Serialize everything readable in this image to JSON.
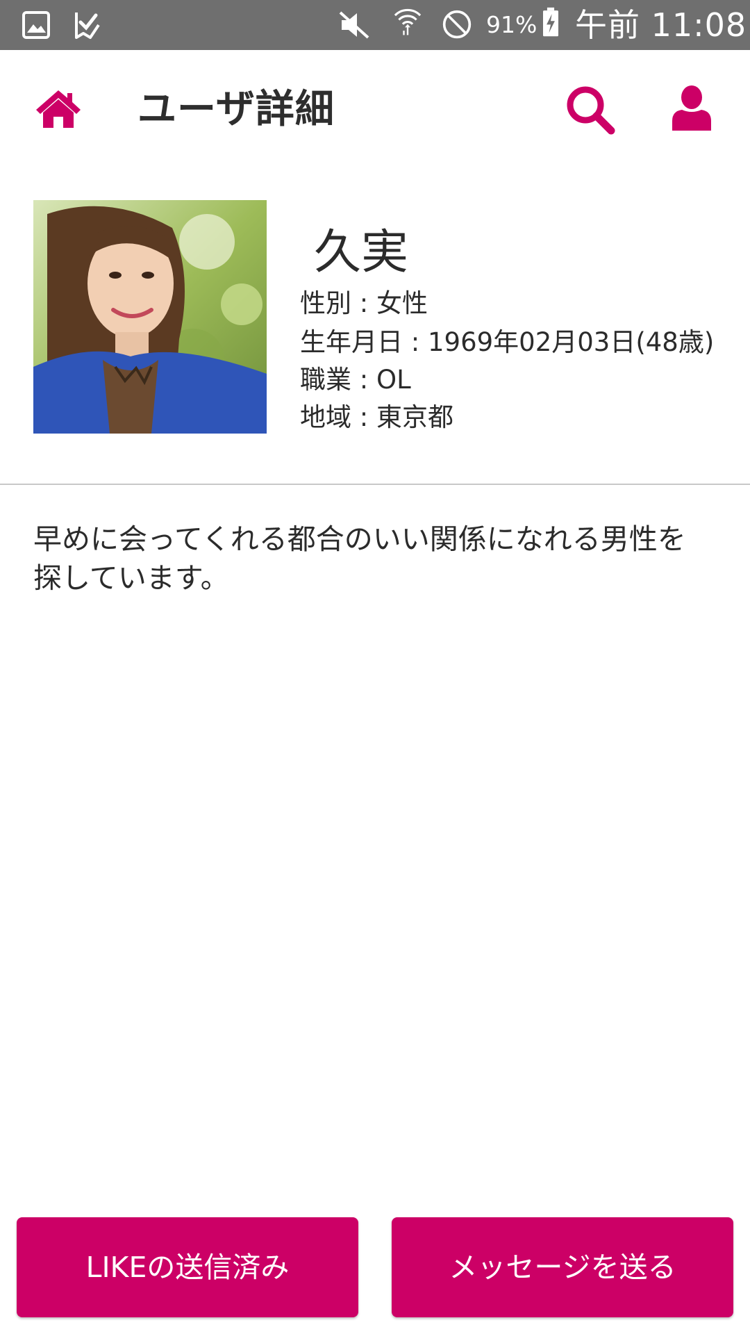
{
  "status_bar": {
    "battery_percent": "91%",
    "time": "午前 11:08",
    "icons": [
      "gallery-icon",
      "task-check-icon",
      "mute-icon",
      "wifi-icon",
      "do-not-disturb-icon",
      "battery-charging-icon"
    ]
  },
  "header": {
    "title": "ユーザ詳細",
    "icons": [
      "home-icon",
      "search-icon",
      "user-icon"
    ]
  },
  "profile": {
    "name": "久実",
    "gender_label": "性別",
    "gender_value": "女性",
    "birthday_label": "生年月日",
    "birthday_value": "1969年02月03日(48歳)",
    "occupation_label": "職業",
    "occupation_value": "OL",
    "region_label": "地域",
    "region_value": "東京都",
    "separator": " : "
  },
  "bio": "早めに会ってくれる都合のいい関係になれる男性を探しています。",
  "buttons": {
    "like_sent": "LIKEの送信済み",
    "send_message": "メッセージを送る"
  },
  "colors": {
    "accent": "#cc0066",
    "status_bar": "#6f6f6f",
    "text": "#2b2b2b"
  }
}
